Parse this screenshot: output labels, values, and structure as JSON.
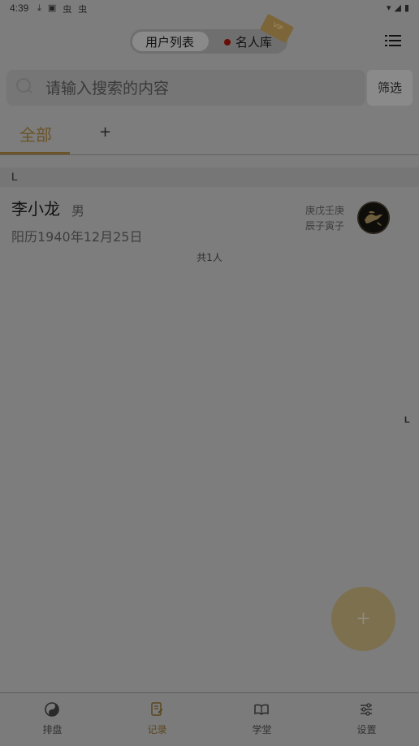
{
  "status_bar": {
    "time": "4:39",
    "left_icons": [
      "⤓",
      "▣",
      "虫",
      "虫"
    ],
    "right_icons": [
      "▾",
      "◢",
      "▮"
    ]
  },
  "header": {
    "segment_user_list": "用户列表",
    "segment_celebrity": "名人库",
    "vip_badge": "VIP",
    "menu_icon": "list-menu-icon"
  },
  "search": {
    "placeholder": "请输入搜索的内容",
    "filter_label": "筛选"
  },
  "tabs": {
    "all_label": "全部",
    "add_label": "+"
  },
  "list": {
    "section_letter": "L",
    "items": [
      {
        "name": "李小龙",
        "gender": "男",
        "birth": "阳历1940年12月25日",
        "bazi_line1": "庚戊壬庚",
        "bazi_line2": "辰子寅子"
      }
    ],
    "total": "共1人"
  },
  "index_bar": {
    "letter": "L"
  },
  "fab": {
    "label": "+"
  },
  "bottom_nav": [
    {
      "label": "排盘",
      "icon": "yin-yang-icon"
    },
    {
      "label": "记录",
      "icon": "notebook-icon",
      "active": true
    },
    {
      "label": "学堂",
      "icon": "book-icon"
    },
    {
      "label": "设置",
      "icon": "sliders-icon"
    }
  ],
  "colors": {
    "accent_gold": "#6b5428",
    "overlay": "#7d7d7d",
    "red_dot": "#6a0c07"
  }
}
